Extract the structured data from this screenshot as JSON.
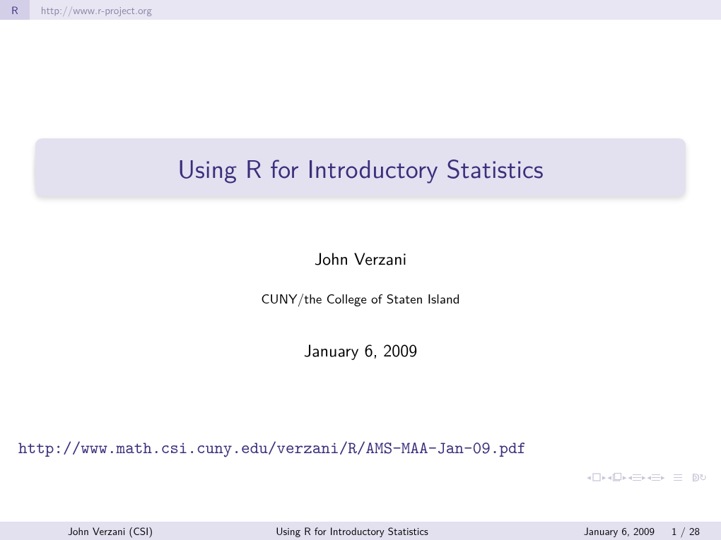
{
  "header": {
    "tab": "R",
    "subtitle": "http://www.r-project.org"
  },
  "title": "Using R for Introductory Statistics",
  "author": "John Verzani",
  "affiliation": "CUNY/the College of Staten Island",
  "date": "January 6, 2009",
  "url": "http://www.math.csi.cuny.edu/verzani/R/AMS-MAA-Jan-09.pdf",
  "footer": {
    "author_short": "John Verzani  (CSI)",
    "title_short": "Using R for Introductory Statistics",
    "date": "January 6, 2009",
    "page": "1 / 28"
  }
}
